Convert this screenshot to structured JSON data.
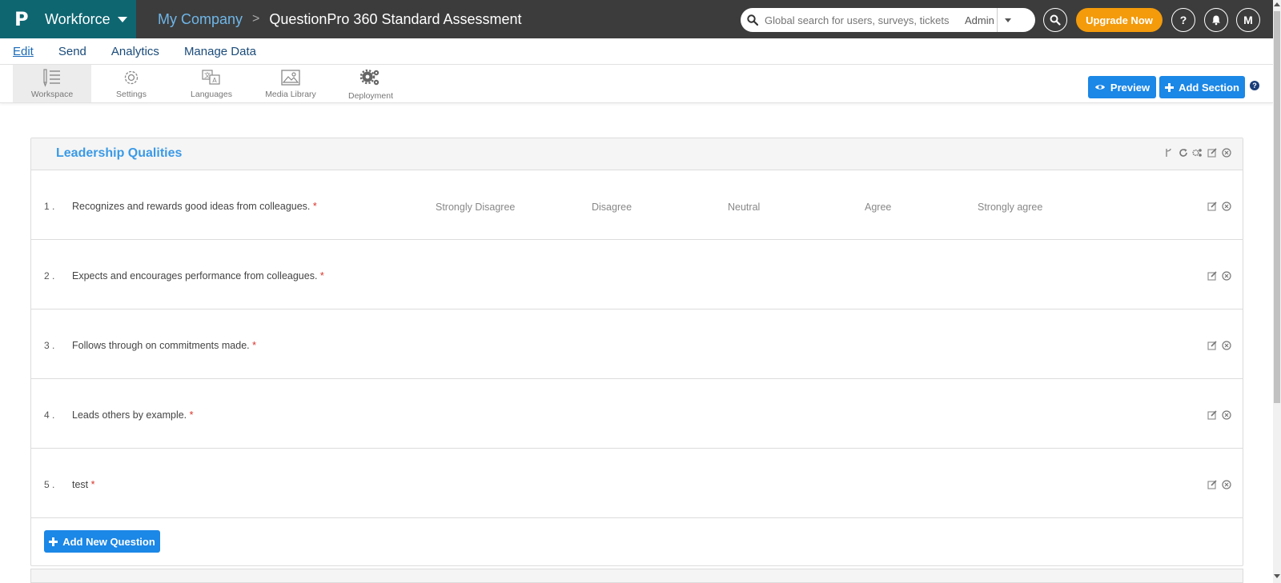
{
  "header": {
    "logo_glyph": "P",
    "product": "Workforce",
    "breadcrumb": "My Company",
    "survey_title": "QuestionPro 360 Standard Assessment",
    "search_placeholder": "Global search for users, surveys, tickets",
    "search_scope": "Admin",
    "upgrade_label": "Upgrade Now",
    "help_glyph": "?",
    "avatar_initial": "M",
    "colors": {
      "bar": "#3c3c3c",
      "brand": "#0e6671",
      "upgrade": "#f49b0b"
    }
  },
  "nav": {
    "items": [
      {
        "label": "Edit",
        "active": true
      },
      {
        "label": "Send",
        "active": false
      },
      {
        "label": "Analytics",
        "active": false
      },
      {
        "label": "Manage Data",
        "active": false
      }
    ]
  },
  "toolbar": {
    "tools": [
      {
        "label": "Workspace",
        "icon": "workspace-icon",
        "active": true
      },
      {
        "label": "Settings",
        "icon": "gear-icon",
        "active": false
      },
      {
        "label": "Languages",
        "icon": "translate-icon",
        "active": false
      },
      {
        "label": "Media Library",
        "icon": "image-icon",
        "active": false
      },
      {
        "label": "Deployment",
        "icon": "gears-icon",
        "active": false
      }
    ],
    "preview_label": "Preview",
    "add_section_label": "Add Section",
    "help_glyph": "?"
  },
  "section": {
    "title": "Leadership Qualities",
    "scale": [
      "Strongly Disagree",
      "Disagree",
      "Neutral",
      "Agree",
      "Strongly agree"
    ],
    "questions": [
      {
        "num": "1 .",
        "text": "Recognizes and rewards good ideas from colleagues.",
        "required": "*"
      },
      {
        "num": "2 .",
        "text": "Expects and encourages performance from colleagues.",
        "required": "*"
      },
      {
        "num": "3 .",
        "text": "Follows through on commitments made.",
        "required": "*"
      },
      {
        "num": "4 .",
        "text": "Leads others by example.",
        "required": "*"
      },
      {
        "num": "5 .",
        "text": "test",
        "required": "*"
      }
    ],
    "add_question_label": "Add New Question"
  }
}
